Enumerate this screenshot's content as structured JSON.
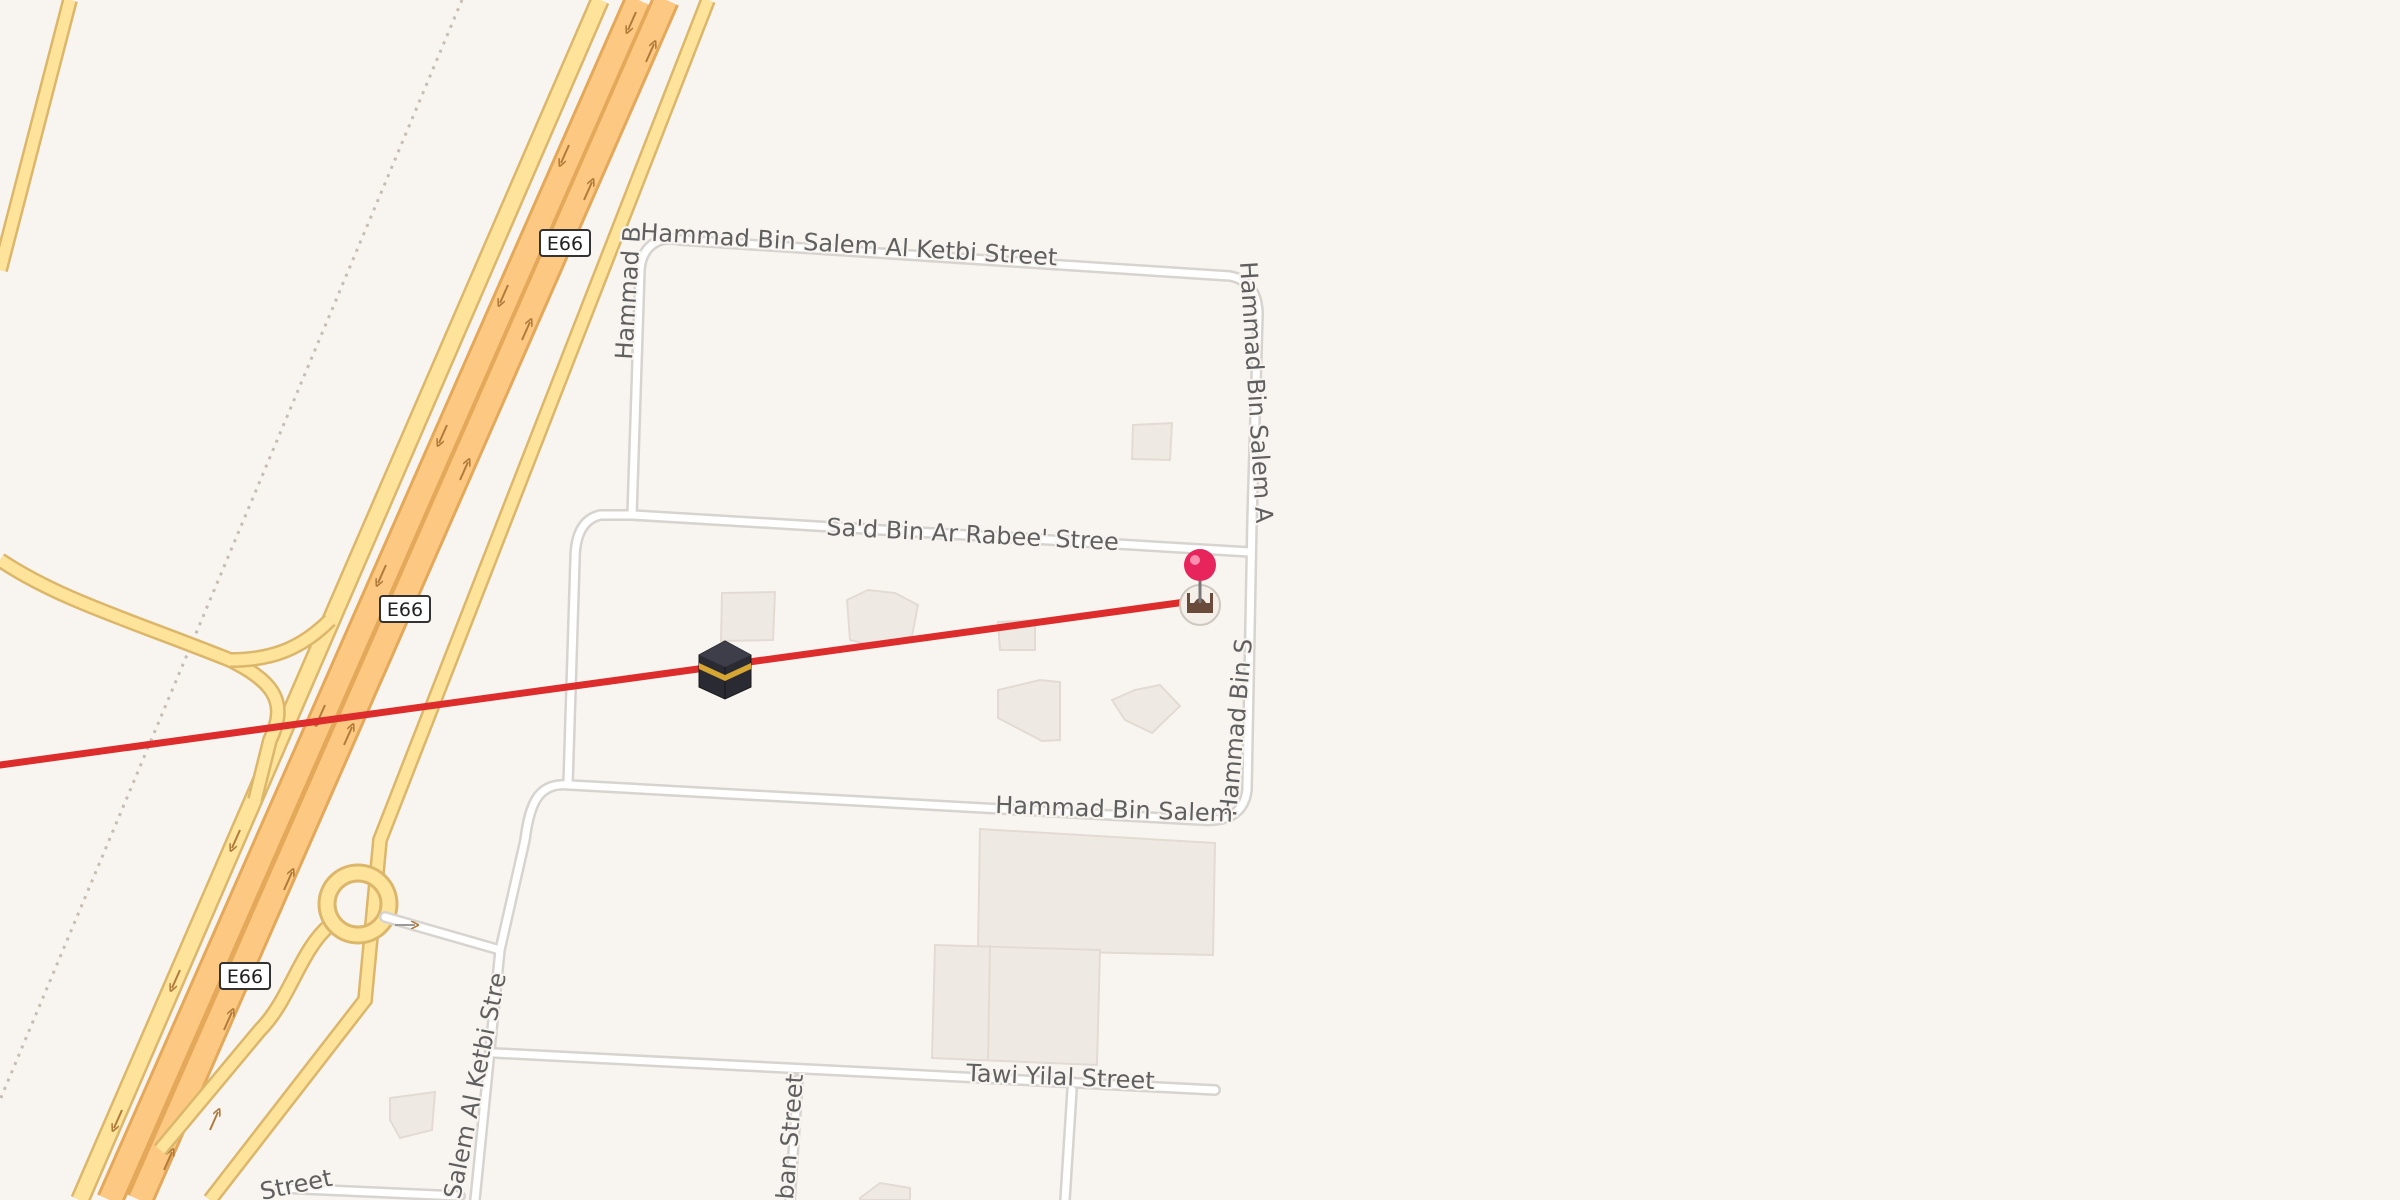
{
  "map": {
    "colors": {
      "background": "#f8f5f1",
      "motorway_fill": "#fdc982",
      "motorway_casing": "#e4a85a",
      "trunk_fill": "#fde49a",
      "trunk_casing": "#dcb66a",
      "minor_road_fill": "#ffffff",
      "minor_road_casing": "#d7d3ce",
      "building": "#efe9e3",
      "building_edge": "#e3dbd3",
      "route_line": "#dd2c2c",
      "pin": "#e8245d"
    },
    "highway_shields": [
      "E66",
      "E66",
      "E66"
    ],
    "street_labels": {
      "north_a": "Hammad Bin Salem Al Ketbi Street",
      "north_b": "Hammad Bin Salem Al Ketbi Street",
      "west": "Hammad Bin Salem Al Ketbi Street",
      "east_upper": "Hammad Bin Salem Al Ketbi Street",
      "east_lower": "Hammad Bin Salem Al Ketbi Street",
      "south": "Hammad Bin Salem Al Ketbi Street",
      "sad": "Sa'd Bin Ar Rabee' Street",
      "tawi": "Tawi Yilal Street",
      "southwest": "Salem Al Ketbi Street",
      "bottom_left": "Street",
      "bottom_mid": "ban Street"
    },
    "icons": {
      "qibla_marker": "kaaba-icon",
      "mosque_marker": "mosque-icon",
      "location_pin": "location-pin-icon"
    }
  }
}
